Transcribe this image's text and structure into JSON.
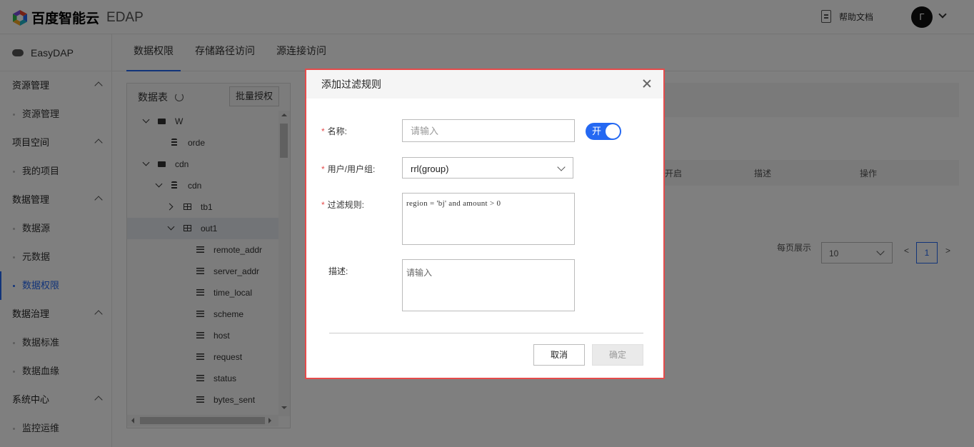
{
  "header": {
    "brand": "百度智能云",
    "product": "EDAP",
    "help_label": "帮助文档",
    "avatar_initial": "Γ"
  },
  "sidebar": {
    "app_name": "EasyDAP",
    "groups": [
      {
        "label": "资源管理",
        "items": [
          "资源管理"
        ]
      },
      {
        "label": "项目空间",
        "items": [
          "我的项目"
        ]
      },
      {
        "label": "数据管理",
        "items": [
          "数据源",
          "元数据",
          "数据权限"
        ]
      },
      {
        "label": "数据治理",
        "items": [
          "数据标准",
          "数据血缘"
        ]
      },
      {
        "label": "系统中心",
        "items": [
          "监控运维"
        ]
      }
    ],
    "active_item": "数据权限"
  },
  "tabs": [
    "数据权限",
    "存储路径访问",
    "源连接访问"
  ],
  "tree": {
    "title": "数据表",
    "batch_button": "批量授权",
    "nodes": [
      {
        "label": "W",
        "type": "folder",
        "expanded": true
      },
      {
        "label": "orde",
        "type": "database"
      },
      {
        "label": "cdn",
        "type": "folder",
        "expanded": true
      },
      {
        "label": "cdn",
        "type": "database",
        "expanded": true
      },
      {
        "label": "tb1",
        "type": "table",
        "expanded": false
      },
      {
        "label": "out1",
        "type": "table",
        "expanded": true,
        "selected": true
      },
      {
        "label": "remote_addr",
        "type": "column"
      },
      {
        "label": "server_addr",
        "type": "column"
      },
      {
        "label": "time_local",
        "type": "column"
      },
      {
        "label": "scheme",
        "type": "column"
      },
      {
        "label": "host",
        "type": "column"
      },
      {
        "label": "request",
        "type": "column"
      },
      {
        "label": "status",
        "type": "column"
      },
      {
        "label": "bytes_sent",
        "type": "column"
      }
    ]
  },
  "content": {
    "columns": [
      "开启",
      "描述",
      "操作"
    ],
    "per_page_label": "每页展示",
    "per_page_value": "10",
    "current_page": "1"
  },
  "modal": {
    "title": "添加过滤规则",
    "name_label": "名称:",
    "name_placeholder": "请输入",
    "toggle_label": "开",
    "toggle_on": true,
    "user_label": "用户/用户组:",
    "user_value": "rrl(group)",
    "rule_label": "过滤规则:",
    "rule_value": "region = 'bj' and amount > 0",
    "desc_label": "描述:",
    "desc_placeholder": "请输入",
    "cancel_label": "取消",
    "ok_label": "确定"
  },
  "colors": {
    "accent": "#2468f2",
    "required": "#e54b4b",
    "modal_border": "#e54b4b"
  }
}
